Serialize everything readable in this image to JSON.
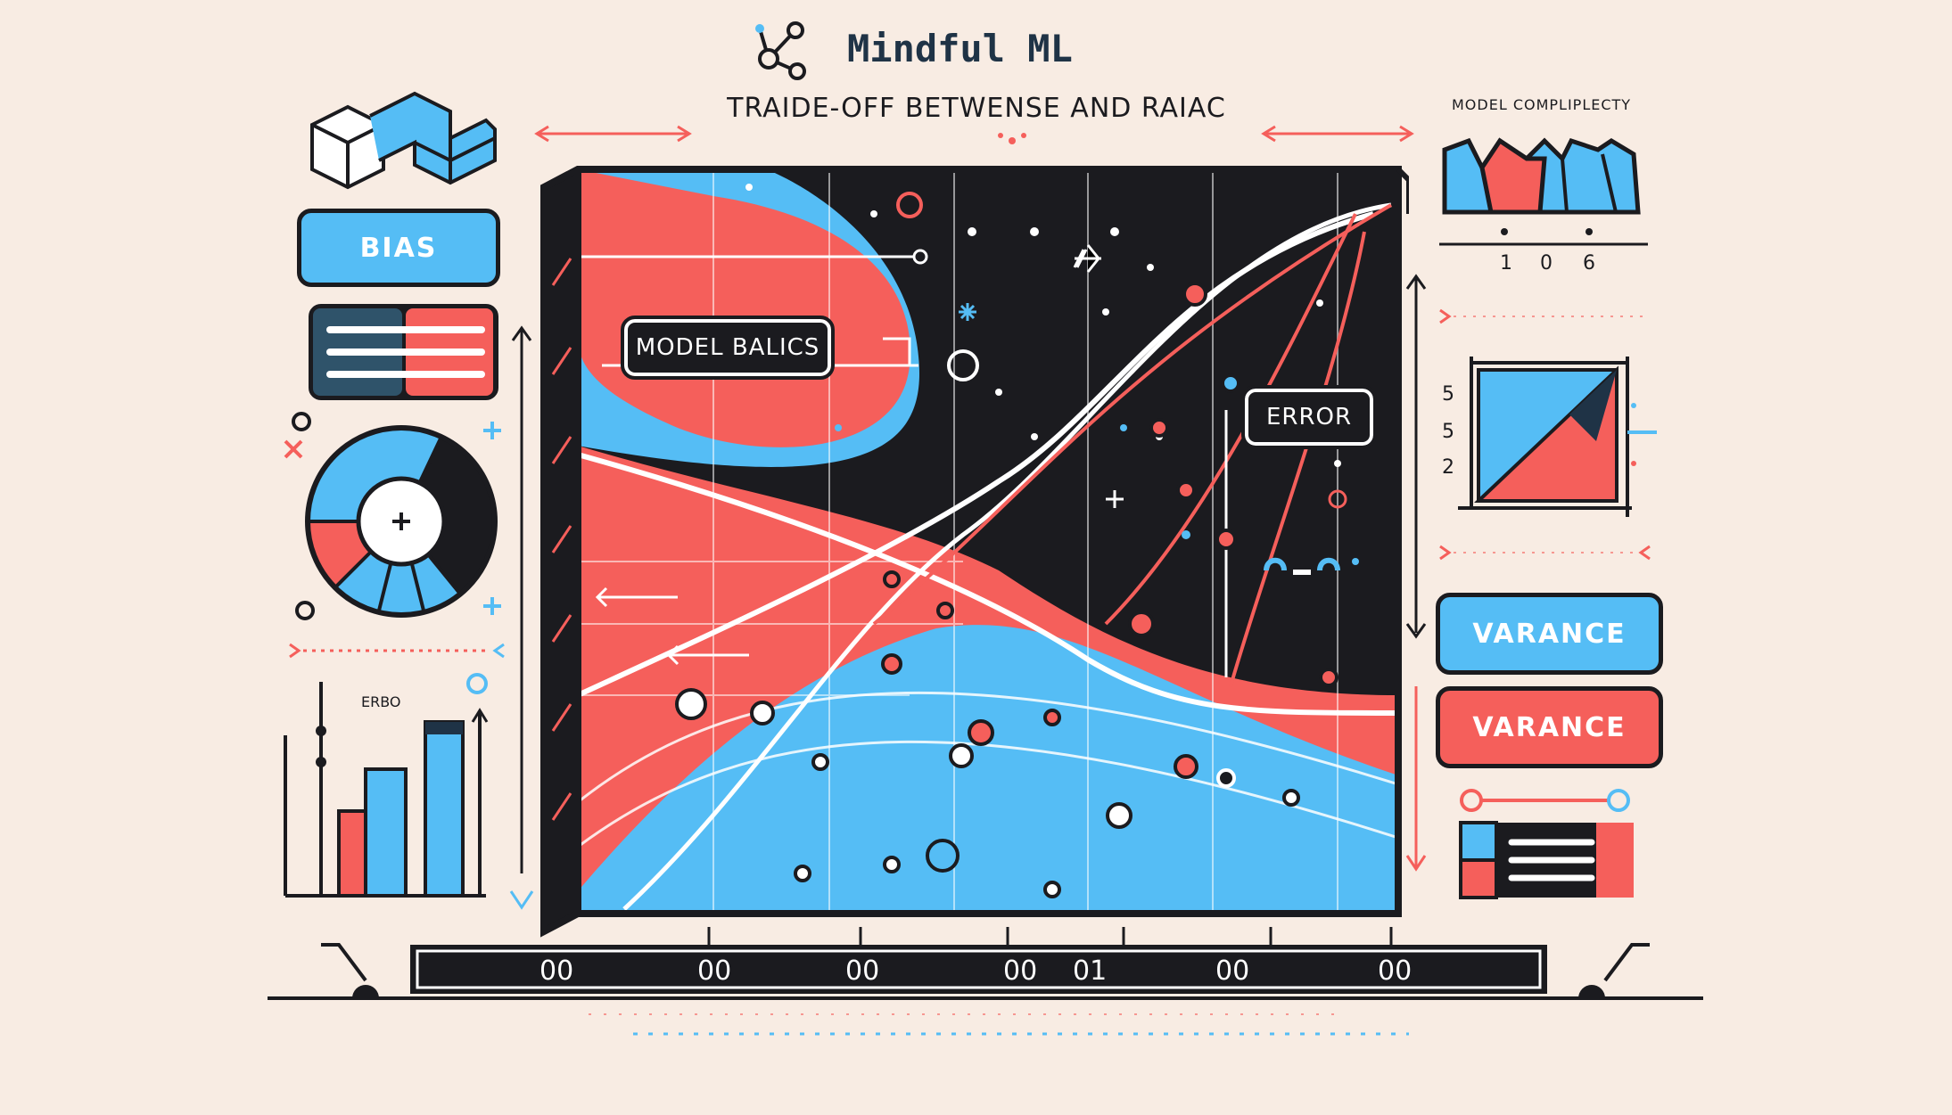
{
  "brand": {
    "name": "Mindful ML",
    "icon": "molecule-icon"
  },
  "title": "TRAIDE-OFF BETWENSE AND RAIAC",
  "top_right_label": "MODEL COMPLIPLECTY",
  "top_right_ticks": [
    "1",
    "0",
    "6"
  ],
  "left_panel": {
    "bias_button": "BIAS",
    "erbo_label": "ERBO"
  },
  "main_chart": {
    "model_label": "MODEL BALICS",
    "error_label": "ERROR",
    "axis_ticks": [
      "00",
      "00",
      "00",
      "00",
      "01",
      "00",
      "00"
    ]
  },
  "right_panel": {
    "y_ticks": [
      "5",
      "5",
      "2"
    ],
    "variance_blue": "VARANCE",
    "variance_red": "VARANCE"
  },
  "colors": {
    "blue": "#55bdf5",
    "red": "#f55f5b",
    "dark": "#1b1b1f",
    "background": "#f8ece3"
  }
}
